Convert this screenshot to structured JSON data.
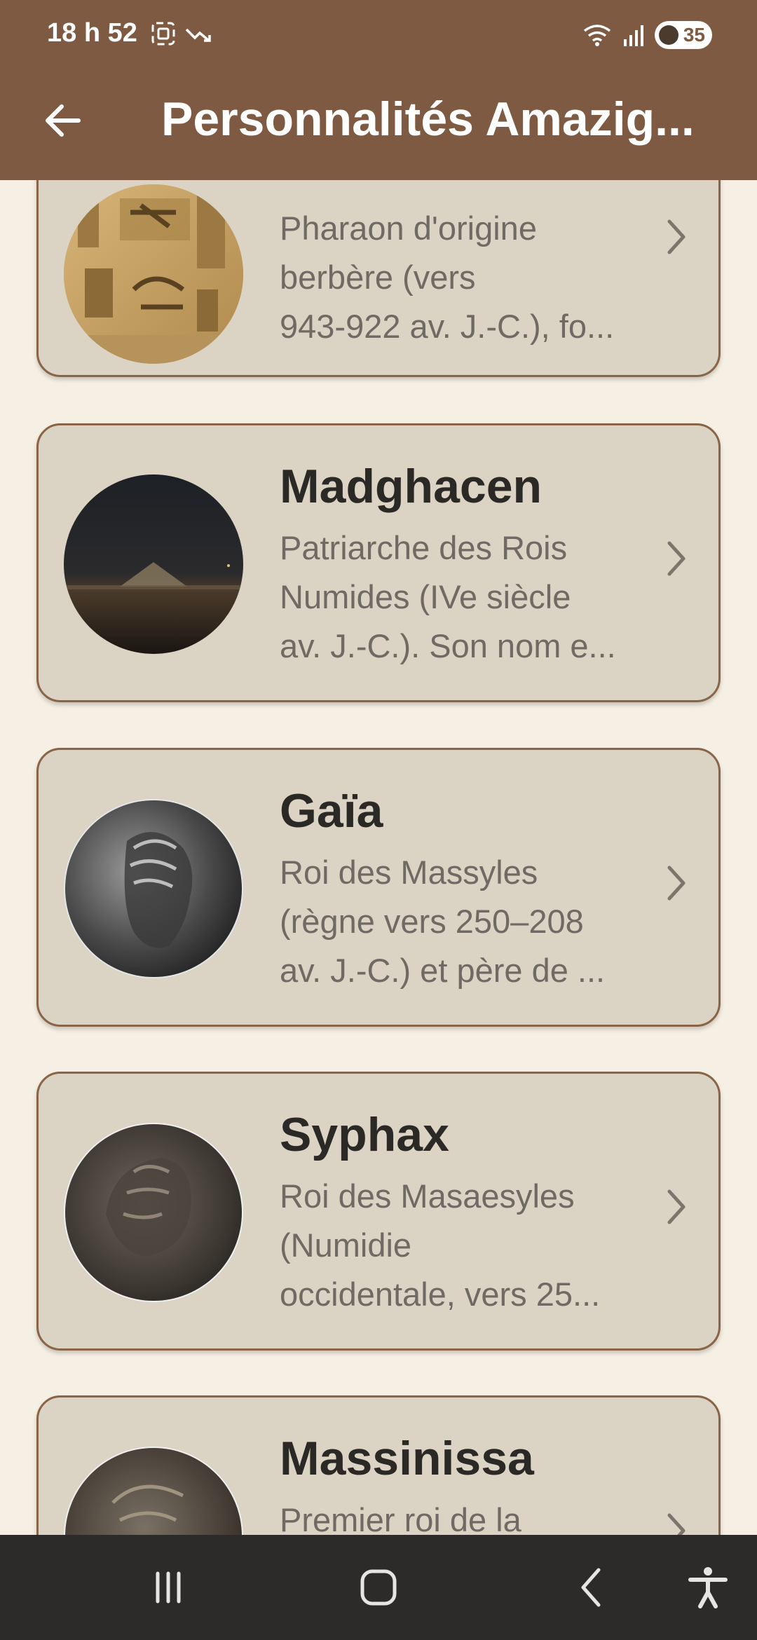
{
  "status_bar": {
    "time": "18 h 52",
    "battery": "35"
  },
  "app_bar": {
    "title": "Personnalités Amazig..."
  },
  "cards": [
    {
      "name": "",
      "desc_lines": [
        "Pharaon d'origine",
        "berbère (vers",
        "943-922 av. J.-C.), fo..."
      ],
      "avatar": "hieroglyph-relief"
    },
    {
      "name": "Madghacen",
      "desc_lines": [
        "Patriarche des Rois",
        "Numides (IVe siècle",
        "av. J.-C.). Son nom e..."
      ],
      "avatar": "night-mausoleum"
    },
    {
      "name": "Gaïa",
      "desc_lines": [
        "Roi des Massyles",
        "(règne vers 250–208",
        "av. J.-C.) et père de ..."
      ],
      "avatar": "silver-coin"
    },
    {
      "name": "Syphax",
      "desc_lines": [
        "Roi des Masaesyles",
        "(Numidie",
        "occidentale, vers 25..."
      ],
      "avatar": "bronze-coin"
    },
    {
      "name": "Massinissa",
      "desc_lines": [
        "Premier roi de la"
      ],
      "avatar": "bronze-coin-2"
    }
  ],
  "colors": {
    "header": "#7d5a41",
    "background": "#f6efe3",
    "card": "#dbd3c4",
    "card_border": "#8a6446",
    "nav_bar": "#2c2b29"
  }
}
